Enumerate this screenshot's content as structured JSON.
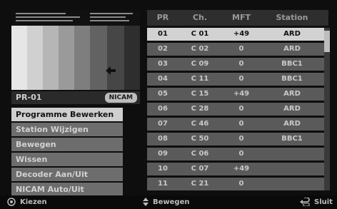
{
  "preview": {
    "channel_label": "PR-01",
    "badge": "NICAM"
  },
  "menu": {
    "items": [
      {
        "label": "Programme Bewerken",
        "selected": true
      },
      {
        "label": "Station Wijzigen",
        "selected": false
      },
      {
        "label": "Bewegen",
        "selected": false
      },
      {
        "label": "Wissen",
        "selected": false
      },
      {
        "label": "Decoder Aan/Uit",
        "selected": false
      },
      {
        "label": "NICAM Auto/Uit",
        "selected": false
      }
    ]
  },
  "table": {
    "headers": {
      "pr": "PR",
      "ch": "Ch.",
      "mft": "MFT",
      "station": "Station"
    },
    "rows": [
      {
        "pr": "01",
        "ch": "C 01",
        "mft": "+49",
        "station": "ARD",
        "selected": true
      },
      {
        "pr": "02",
        "ch": "C 02",
        "mft": "0",
        "station": "ARD"
      },
      {
        "pr": "03",
        "ch": "C 09",
        "mft": "0",
        "station": "BBC1"
      },
      {
        "pr": "04",
        "ch": "C 11",
        "mft": "0",
        "station": "BBC1"
      },
      {
        "pr": "05",
        "ch": "C 15",
        "mft": "+49",
        "station": "ARD"
      },
      {
        "pr": "06",
        "ch": "C 28",
        "mft": "0",
        "station": "ARD"
      },
      {
        "pr": "07",
        "ch": "C 46",
        "mft": "0",
        "station": "ARD"
      },
      {
        "pr": "08",
        "ch": "C 50",
        "mft": "0",
        "station": "BBC1"
      },
      {
        "pr": "09",
        "ch": "C 06",
        "mft": "0",
        "station": ""
      },
      {
        "pr": "10",
        "ch": "C 07",
        "mft": "+49",
        "station": ""
      },
      {
        "pr": "11",
        "ch": "C 21",
        "mft": "0",
        "station": ""
      }
    ]
  },
  "footer": {
    "select": {
      "icon": "select-button-icon",
      "label": "Kiezen"
    },
    "move": {
      "icon": "up-down-arrows-icon",
      "label": "Bewegen"
    },
    "close": {
      "icon": "return-icon",
      "label": "Sluit"
    }
  },
  "colors": {
    "selected_bg": "#d2d2d2",
    "row_bg": "#5a5a5a",
    "menu_bg": "#6d6d6d"
  }
}
